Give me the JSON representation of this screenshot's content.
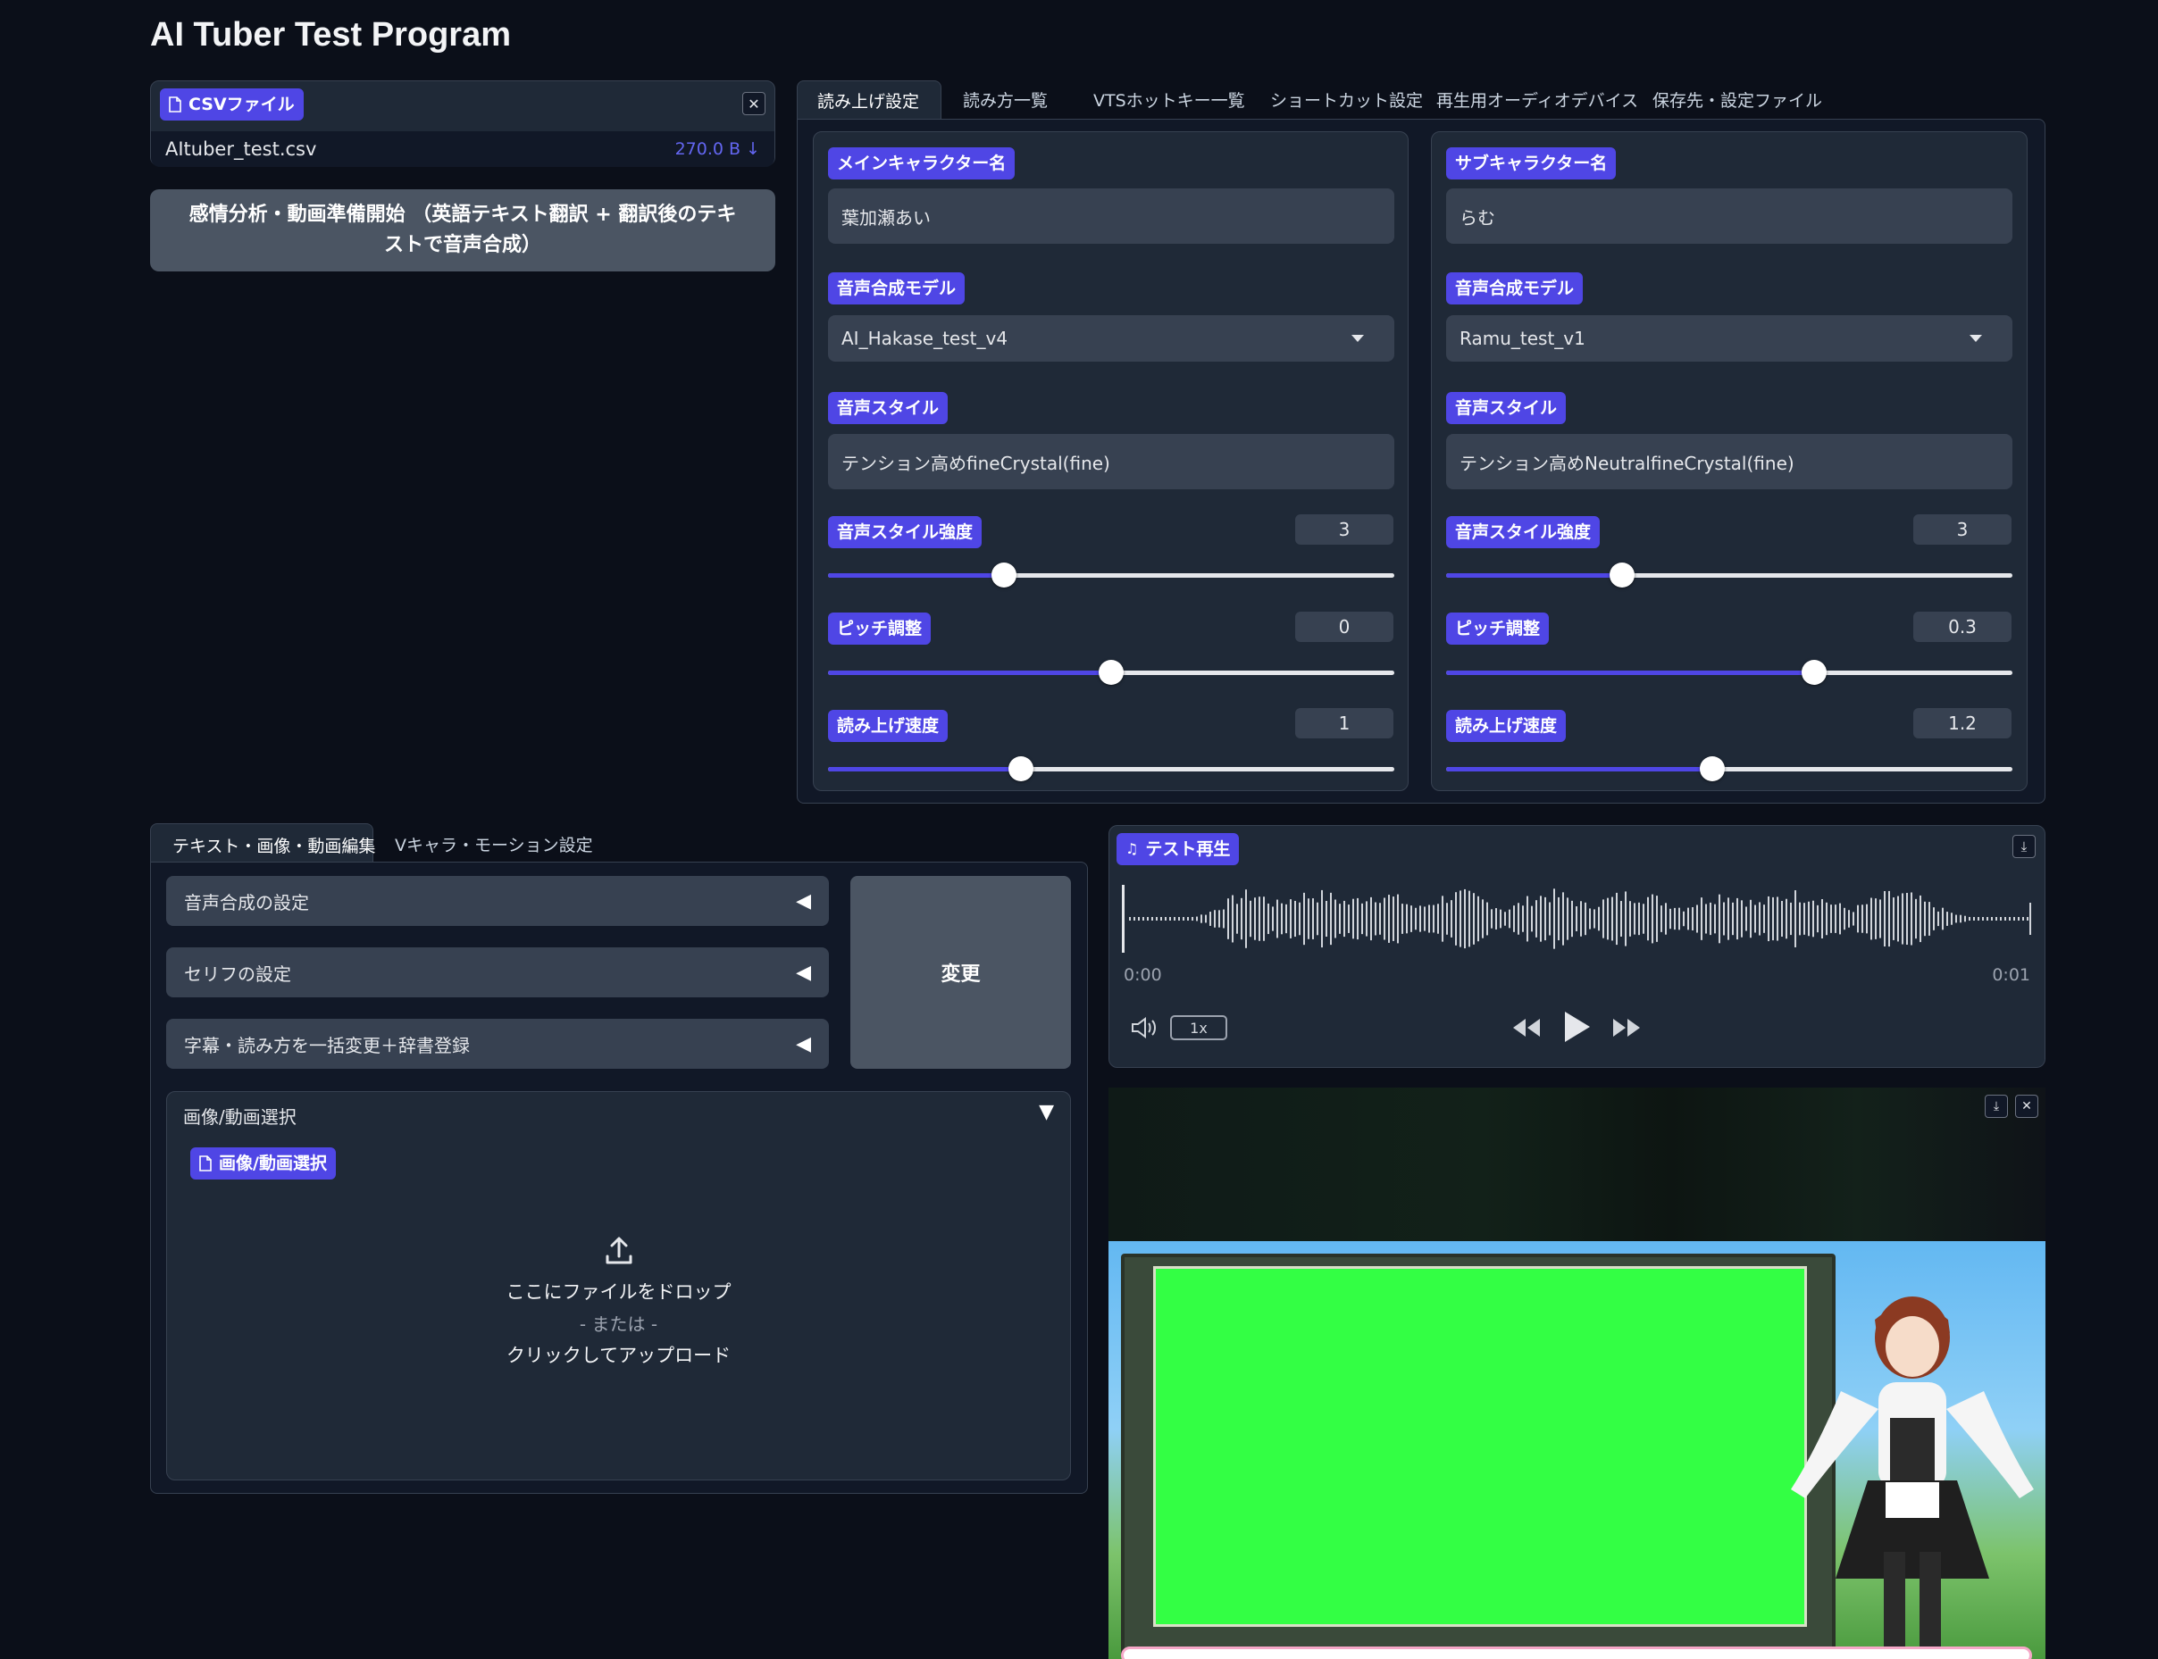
{
  "app": {
    "title": "AI Tuber Test Program"
  },
  "csv": {
    "label": "CSVファイル",
    "filename": "AItuber_test.csv",
    "filesize": "270.0 B ↓",
    "start_button": "感情分析・動画準備開始 （英語テキスト翻訳 + 翻訳後のテキストで音声合成）"
  },
  "settings_tabs": [
    "読み上げ設定",
    "読み方一覧",
    "VTSホットキー一覧",
    "ショートカット設定",
    "再生用オーディオデバイス",
    "保存先・設定ファイル"
  ],
  "main_char": {
    "name_label": "メインキャラクター名",
    "name_value": "葉加瀬あい",
    "model_label": "音声合成モデル",
    "model_value": "AI_Hakase_test_v4",
    "style_label": "音声スタイル",
    "style_value": "テンション高めfineCrystal(fine)",
    "strength_label": "音声スタイル強度",
    "strength_value": "3",
    "strength_fraction": 0.31,
    "pitch_label": "ピッチ調整",
    "pitch_value": "0",
    "pitch_fraction": 0.5,
    "speed_label": "読み上げ速度",
    "speed_value": "1",
    "speed_fraction": 0.34
  },
  "sub_char": {
    "name_label": "サブキャラクター名",
    "name_value": "らむ",
    "model_label": "音声合成モデル",
    "model_value": "Ramu_test_v1",
    "style_label": "音声スタイル",
    "style_value": "テンション高めNeutralfineCrystal(fine)",
    "strength_label": "音声スタイル強度",
    "strength_value": "3",
    "strength_fraction": 0.31,
    "pitch_label": "ピッチ調整",
    "pitch_value": "0.3",
    "pitch_fraction": 0.65,
    "speed_label": "読み上げ速度",
    "speed_value": "1.2",
    "speed_fraction": 0.47
  },
  "edit_tabs": [
    "テキスト・画像・動画編集",
    "Vキャラ・モーション設定"
  ],
  "accordions": [
    "音声合成の設定",
    "セリフの設定",
    "字幕・読み方を一括変更＋辞書登録"
  ],
  "change_button": "変更",
  "media_select": {
    "title": "画像/動画選択",
    "badge": "画像/動画選択",
    "drop_text": "ここにファイルをドロップ",
    "or_text": "- または -",
    "click_text": "クリックしてアップロード"
  },
  "audio": {
    "label": "テスト再生",
    "time_start": "0:00",
    "time_end": "0:01",
    "speed": "1x"
  },
  "colors": {
    "background": "#0b0f19",
    "panel": "#1f2937",
    "field": "#374151",
    "accent": "#4f46e5",
    "green_screen": "#33ff44"
  }
}
